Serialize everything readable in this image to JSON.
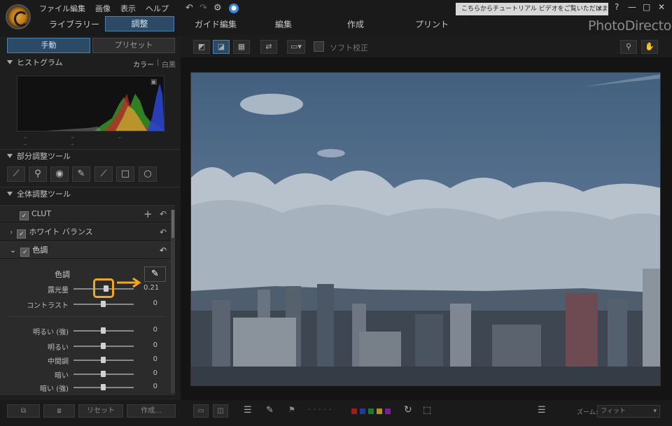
{
  "menu": [
    "ファイル",
    "編集",
    "画像",
    "表示",
    "ヘルプ"
  ],
  "main_tabs": [
    "ライブラリー",
    "調整",
    "ガイド編集",
    "編集",
    "作成",
    "プリント"
  ],
  "tip": "こちらからチュートリアル ビデオをご覧いただけます。",
  "tip_close": "✕",
  "brand": "PhotoDirector",
  "help": "?",
  "window": {
    "minimize": "—",
    "maximize": "□",
    "close": "✕"
  },
  "sub_tabs": {
    "manual": "手動",
    "preset": "プリセット"
  },
  "histogram": {
    "title": "ヒストグラム",
    "color": "カラー",
    "mono": "白黒",
    "ticks": "– – – – –"
  },
  "local_tools": {
    "title": "部分調整ツール"
  },
  "global_tools": {
    "title": "全体調整ツール"
  },
  "rows": {
    "clut": "CLUT",
    "white_balance": "ホワイト バランス",
    "tone": "色調"
  },
  "tone": {
    "label": "色調",
    "sliders": [
      {
        "label": "露光量",
        "value": "0.21",
        "level": 0.55
      },
      {
        "label": "コントラスト",
        "value": "0",
        "level": 0.5
      },
      {
        "label": "明るい (強)",
        "value": "0",
        "level": 0.5
      },
      {
        "label": "明るい",
        "value": "0",
        "level": 0.5
      },
      {
        "label": "中間調",
        "value": "0",
        "level": 0.5
      },
      {
        "label": "暗い",
        "value": "0",
        "level": 0.5
      },
      {
        "label": "暗い (強)",
        "value": "0",
        "level": 0.5
      }
    ]
  },
  "bottom": {
    "reset": "リセット",
    "create": "作成..."
  },
  "soft_proof": "ソフト校正",
  "zoom": {
    "label": "ズーム:",
    "value": "フィット"
  },
  "colors": {
    "accent": "#2c4a66",
    "highlight": "#f0a81c"
  }
}
